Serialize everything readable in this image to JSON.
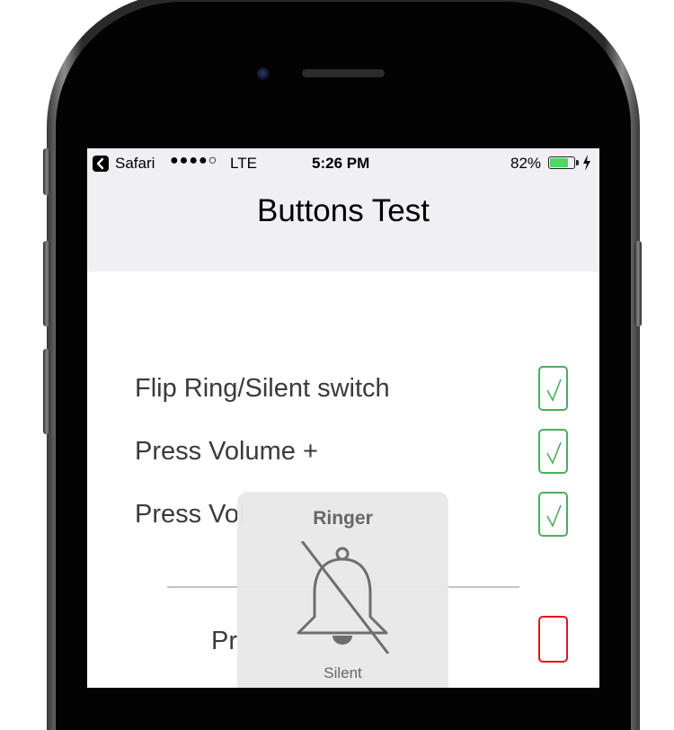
{
  "status_bar": {
    "back_app": "Safari",
    "signal": "●●●●○",
    "network": "LTE",
    "time": "5:26 PM",
    "battery": "82%",
    "battery_level": 0.82,
    "battery_color": "#4cd964",
    "icons": [
      "back-arrow-icon",
      "battery-icon",
      "charging-bolt-icon"
    ]
  },
  "nav": {
    "title": "Buttons Test"
  },
  "tests": [
    {
      "label": "Flip Ring/Silent switch",
      "status": "passed"
    },
    {
      "label": "Press Volume +",
      "status": "passed"
    },
    {
      "label": "Press Vol",
      "status": "passed"
    }
  ],
  "lower_test": {
    "label": "Pr",
    "status": "failed"
  },
  "ringer_hud": {
    "title": "Ringer",
    "subtitle": "Silent",
    "icon": "bell-slash-icon"
  },
  "colors": {
    "pass": "#4cae5a",
    "fail": "#e0151b",
    "nav_background": "#efeff4"
  }
}
